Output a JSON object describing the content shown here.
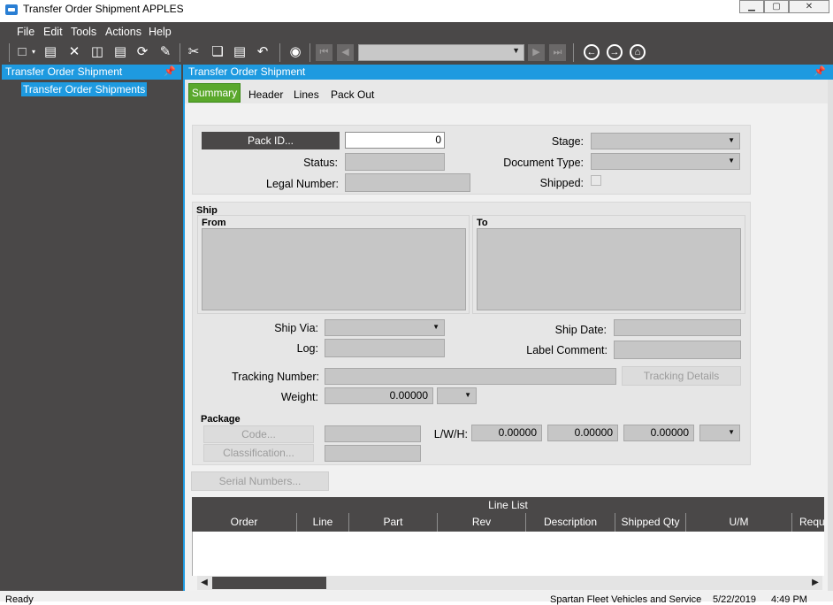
{
  "window": {
    "title": "Transfer Order Shipment APPLES",
    "controls": [
      "minimize-icon",
      "maximize-icon",
      "close-icon"
    ]
  },
  "menu": [
    "File",
    "Edit",
    "Tools",
    "Actions",
    "Help"
  ],
  "toolbar": {
    "icons": [
      "new-icon",
      "save-icon",
      "delete-icon",
      "book-icon",
      "print-icon",
      "refresh-icon",
      "clear-icon",
      "cut-icon",
      "copy-icon",
      "paste-icon",
      "undo-icon",
      "search-icon",
      "first-record-icon",
      "prev-record-icon",
      "next-record-icon",
      "last-record-icon",
      "back-icon",
      "forward-icon",
      "home-icon"
    ],
    "record_selector": ""
  },
  "left_panel": {
    "title": "Transfer Order Shipment",
    "tree_items": [
      "Transfer Order Shipments"
    ]
  },
  "main_panel": {
    "title": "Transfer Order Shipment",
    "tabs": [
      "Summary",
      "Header",
      "Lines",
      "Pack Out"
    ],
    "active_tab": "Summary"
  },
  "header_section": {
    "pack_id_button": "Pack ID...",
    "pack_id_value": "0",
    "status_label": "Status:",
    "legal_number_label": "Legal Number:",
    "stage_label": "Stage:",
    "document_type_label": "Document Type:",
    "shipped_label": "Shipped:"
  },
  "ship_section": {
    "title": "Ship",
    "from_label": "From",
    "to_label": "To",
    "ship_via_label": "Ship Via:",
    "log_label": "Log:",
    "ship_date_label": "Ship Date:",
    "label_comment_label": "Label Comment:",
    "tracking_number_label": "Tracking Number:",
    "tracking_details_button": "Tracking Details",
    "weight_label": "Weight:",
    "weight_value": "0.00000"
  },
  "package_section": {
    "title": "Package",
    "code_button": "Code...",
    "classification_button": "Classification...",
    "lwh_label": "L/W/H:",
    "length": "0.00000",
    "width": "0.00000",
    "height": "0.00000"
  },
  "serial_numbers_button": "Serial Numbers...",
  "grid": {
    "title": "Line List",
    "columns": [
      "Order",
      "Line",
      "Part",
      "Rev",
      "Description",
      "Shipped Qty",
      "U/M",
      "Requ"
    ]
  },
  "status_bar": {
    "left": "Ready",
    "company": "Spartan Fleet Vehicles and Service",
    "date": "5/22/2019",
    "time": "4:49 PM"
  },
  "colors": {
    "accent": "#1e9ae0",
    "dark": "#4a4848",
    "active_tab": "#5aa82c"
  }
}
